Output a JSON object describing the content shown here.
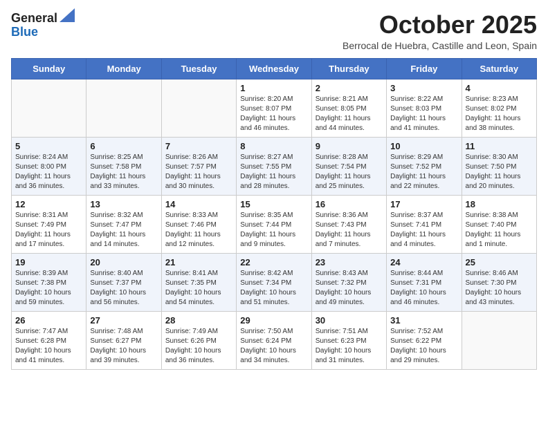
{
  "header": {
    "logo_general": "General",
    "logo_blue": "Blue",
    "month": "October 2025",
    "location": "Berrocal de Huebra, Castille and Leon, Spain"
  },
  "weekdays": [
    "Sunday",
    "Monday",
    "Tuesday",
    "Wednesday",
    "Thursday",
    "Friday",
    "Saturday"
  ],
  "weeks": [
    [
      {
        "day": "",
        "info": ""
      },
      {
        "day": "",
        "info": ""
      },
      {
        "day": "",
        "info": ""
      },
      {
        "day": "1",
        "info": "Sunrise: 8:20 AM\nSunset: 8:07 PM\nDaylight: 11 hours\nand 46 minutes."
      },
      {
        "day": "2",
        "info": "Sunrise: 8:21 AM\nSunset: 8:05 PM\nDaylight: 11 hours\nand 44 minutes."
      },
      {
        "day": "3",
        "info": "Sunrise: 8:22 AM\nSunset: 8:03 PM\nDaylight: 11 hours\nand 41 minutes."
      },
      {
        "day": "4",
        "info": "Sunrise: 8:23 AM\nSunset: 8:02 PM\nDaylight: 11 hours\nand 38 minutes."
      }
    ],
    [
      {
        "day": "5",
        "info": "Sunrise: 8:24 AM\nSunset: 8:00 PM\nDaylight: 11 hours\nand 36 minutes."
      },
      {
        "day": "6",
        "info": "Sunrise: 8:25 AM\nSunset: 7:58 PM\nDaylight: 11 hours\nand 33 minutes."
      },
      {
        "day": "7",
        "info": "Sunrise: 8:26 AM\nSunset: 7:57 PM\nDaylight: 11 hours\nand 30 minutes."
      },
      {
        "day": "8",
        "info": "Sunrise: 8:27 AM\nSunset: 7:55 PM\nDaylight: 11 hours\nand 28 minutes."
      },
      {
        "day": "9",
        "info": "Sunrise: 8:28 AM\nSunset: 7:54 PM\nDaylight: 11 hours\nand 25 minutes."
      },
      {
        "day": "10",
        "info": "Sunrise: 8:29 AM\nSunset: 7:52 PM\nDaylight: 11 hours\nand 22 minutes."
      },
      {
        "day": "11",
        "info": "Sunrise: 8:30 AM\nSunset: 7:50 PM\nDaylight: 11 hours\nand 20 minutes."
      }
    ],
    [
      {
        "day": "12",
        "info": "Sunrise: 8:31 AM\nSunset: 7:49 PM\nDaylight: 11 hours\nand 17 minutes."
      },
      {
        "day": "13",
        "info": "Sunrise: 8:32 AM\nSunset: 7:47 PM\nDaylight: 11 hours\nand 14 minutes."
      },
      {
        "day": "14",
        "info": "Sunrise: 8:33 AM\nSunset: 7:46 PM\nDaylight: 11 hours\nand 12 minutes."
      },
      {
        "day": "15",
        "info": "Sunrise: 8:35 AM\nSunset: 7:44 PM\nDaylight: 11 hours\nand 9 minutes."
      },
      {
        "day": "16",
        "info": "Sunrise: 8:36 AM\nSunset: 7:43 PM\nDaylight: 11 hours\nand 7 minutes."
      },
      {
        "day": "17",
        "info": "Sunrise: 8:37 AM\nSunset: 7:41 PM\nDaylight: 11 hours\nand 4 minutes."
      },
      {
        "day": "18",
        "info": "Sunrise: 8:38 AM\nSunset: 7:40 PM\nDaylight: 11 hours\nand 1 minute."
      }
    ],
    [
      {
        "day": "19",
        "info": "Sunrise: 8:39 AM\nSunset: 7:38 PM\nDaylight: 10 hours\nand 59 minutes."
      },
      {
        "day": "20",
        "info": "Sunrise: 8:40 AM\nSunset: 7:37 PM\nDaylight: 10 hours\nand 56 minutes."
      },
      {
        "day": "21",
        "info": "Sunrise: 8:41 AM\nSunset: 7:35 PM\nDaylight: 10 hours\nand 54 minutes."
      },
      {
        "day": "22",
        "info": "Sunrise: 8:42 AM\nSunset: 7:34 PM\nDaylight: 10 hours\nand 51 minutes."
      },
      {
        "day": "23",
        "info": "Sunrise: 8:43 AM\nSunset: 7:32 PM\nDaylight: 10 hours\nand 49 minutes."
      },
      {
        "day": "24",
        "info": "Sunrise: 8:44 AM\nSunset: 7:31 PM\nDaylight: 10 hours\nand 46 minutes."
      },
      {
        "day": "25",
        "info": "Sunrise: 8:46 AM\nSunset: 7:30 PM\nDaylight: 10 hours\nand 43 minutes."
      }
    ],
    [
      {
        "day": "26",
        "info": "Sunrise: 7:47 AM\nSunset: 6:28 PM\nDaylight: 10 hours\nand 41 minutes."
      },
      {
        "day": "27",
        "info": "Sunrise: 7:48 AM\nSunset: 6:27 PM\nDaylight: 10 hours\nand 39 minutes."
      },
      {
        "day": "28",
        "info": "Sunrise: 7:49 AM\nSunset: 6:26 PM\nDaylight: 10 hours\nand 36 minutes."
      },
      {
        "day": "29",
        "info": "Sunrise: 7:50 AM\nSunset: 6:24 PM\nDaylight: 10 hours\nand 34 minutes."
      },
      {
        "day": "30",
        "info": "Sunrise: 7:51 AM\nSunset: 6:23 PM\nDaylight: 10 hours\nand 31 minutes."
      },
      {
        "day": "31",
        "info": "Sunrise: 7:52 AM\nSunset: 6:22 PM\nDaylight: 10 hours\nand 29 minutes."
      },
      {
        "day": "",
        "info": ""
      }
    ]
  ]
}
